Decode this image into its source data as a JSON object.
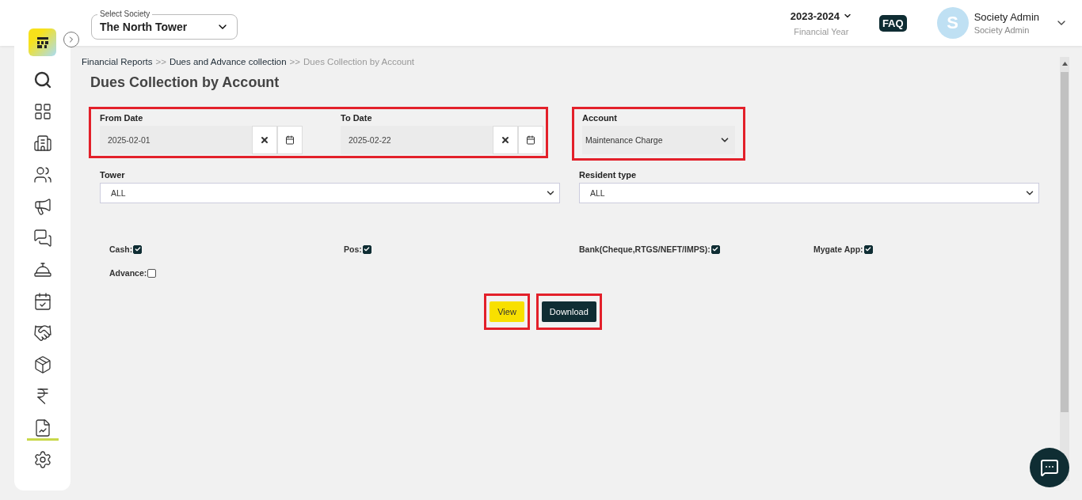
{
  "sidebar": {
    "nav_items": [
      {
        "selected": false
      },
      {
        "selected": false
      },
      {
        "selected": false
      },
      {
        "selected": false
      },
      {
        "selected": false
      },
      {
        "selected": false
      },
      {
        "selected": false
      },
      {
        "selected": false
      },
      {
        "selected": false
      },
      {
        "selected": false
      },
      {
        "selected": false
      },
      {
        "selected": true
      },
      {
        "selected": false
      }
    ]
  },
  "header": {
    "society_select": {
      "label": "Select Society",
      "value": "The North Tower"
    },
    "financial_year": {
      "value": "2023-2024",
      "caption": "Financial Year"
    },
    "faq": "FAQ",
    "user": {
      "initial": "S",
      "name": "Society Admin",
      "role": "Society Admin"
    }
  },
  "breadcrumb": [
    {
      "label": "Financial Reports",
      "current": false
    },
    {
      "label": "Dues and Advance collection",
      "current": false
    },
    {
      "label": "Dues Collection by Account",
      "current": true
    }
  ],
  "breadcrumb_separator": ">>",
  "page_title": "Dues Collection by Account",
  "filters": {
    "from_date": {
      "label": "From Date",
      "value": "2025-02-01"
    },
    "to_date": {
      "label": "To Date",
      "value": "2025-02-22"
    },
    "account": {
      "label": "Account",
      "value": "Maintenance Charge"
    },
    "tower": {
      "label": "Tower",
      "value": "ALL"
    },
    "resident_type": {
      "label": "Resident type",
      "value": "ALL"
    }
  },
  "payment_modes": [
    {
      "label": "Cash:",
      "checked": true
    },
    {
      "label": "Pos:",
      "checked": true
    },
    {
      "label": "Bank(Cheque,RTGS/NEFT/IMPS):",
      "checked": true
    },
    {
      "label": "Mygate App:",
      "checked": true
    },
    {
      "label": "Advance:",
      "checked": false
    }
  ],
  "buttons": [
    {
      "label": "View",
      "kind": "primary"
    },
    {
      "label": "Download",
      "kind": "dark"
    }
  ]
}
